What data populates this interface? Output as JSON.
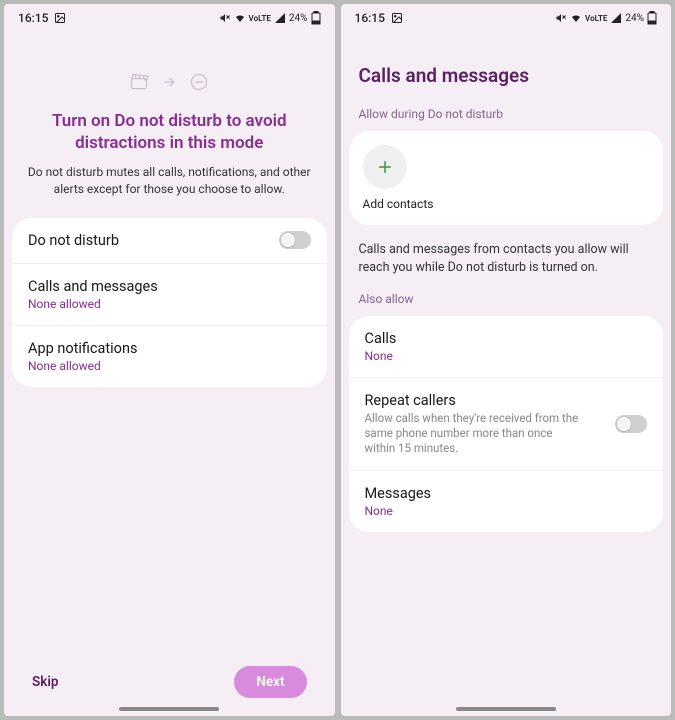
{
  "statusbar": {
    "time": "16:15",
    "battery": "24%"
  },
  "screen1": {
    "title": "Turn on Do not disturb to avoid distractions in this mode",
    "desc": "Do not disturb mutes all calls, notifications, and other alerts except for those you choose to allow.",
    "rows": {
      "dnd": {
        "title": "Do not disturb"
      },
      "calls": {
        "title": "Calls and messages",
        "sub": "None allowed"
      },
      "apps": {
        "title": "App notifications",
        "sub": "None allowed"
      }
    },
    "skip": "Skip",
    "next": "Next"
  },
  "screen2": {
    "title": "Calls and messages",
    "allow_label": "Allow during Do not disturb",
    "add_contacts": "Add contacts",
    "info": "Calls and messages from contacts you allow will reach you while Do not disturb is turned on.",
    "also_allow": "Also allow",
    "rows": {
      "calls": {
        "title": "Calls",
        "sub": "None"
      },
      "repeat": {
        "title": "Repeat callers",
        "desc": "Allow calls when they're received from the same phone number more than once within 15 minutes."
      },
      "messages": {
        "title": "Messages",
        "sub": "None"
      }
    }
  }
}
